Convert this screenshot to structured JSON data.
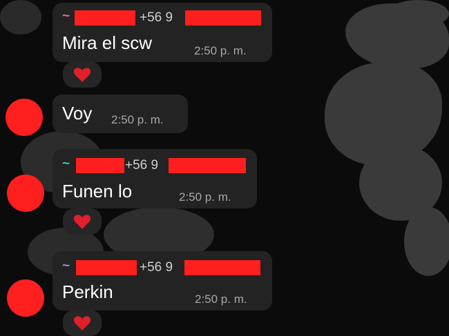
{
  "messages": [
    {
      "sender_prefix": "~",
      "prefix_color": "#e06a9a",
      "phone_prefix": "+56 9",
      "text": "Mira el scw",
      "time": "2:50 p. m.",
      "reaction": "heart",
      "has_avatar": false
    },
    {
      "text": "Voy",
      "time": "2:50 p. m.",
      "has_avatar": true
    },
    {
      "sender_prefix": "~",
      "prefix_color": "#35c6c0",
      "phone_prefix": "+56 9",
      "text": "Funen lo",
      "time": "2:50 p. m.",
      "reaction": "heart",
      "has_avatar": true
    },
    {
      "sender_prefix": "~",
      "prefix_color": "#9a8ae6",
      "phone_prefix": "+56 9",
      "text": "Perkin",
      "time": "2:50 p. m.",
      "reaction": "heart",
      "has_avatar": true
    }
  ],
  "colors": {
    "redaction": "#ff1f1f",
    "bubble": "#232323",
    "heart": "#e0202a"
  }
}
